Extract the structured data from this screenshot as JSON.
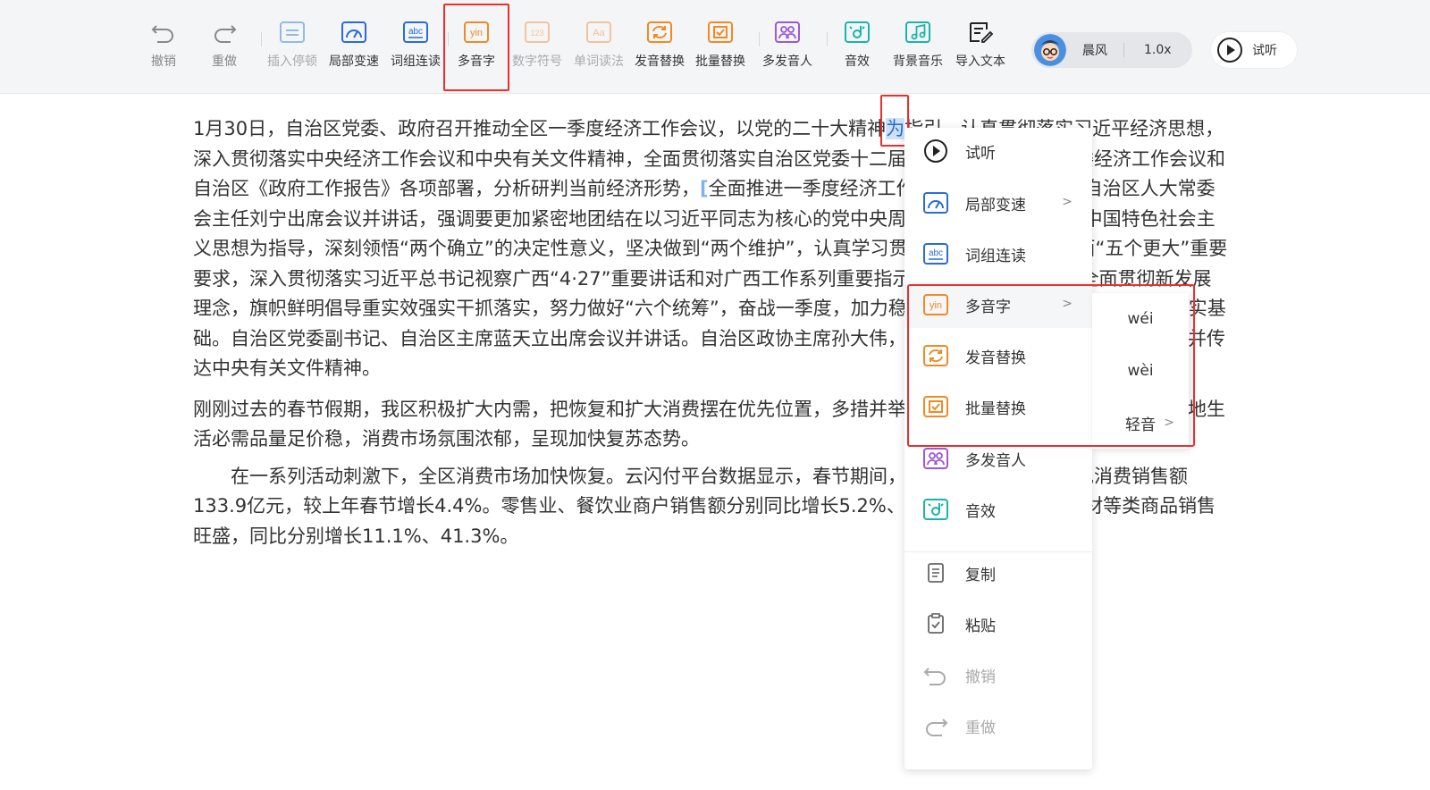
{
  "toolbar": {
    "undo": "撤销",
    "redo": "重做",
    "insert_pause": "插入停顿",
    "local_speed": "局部变速",
    "word_link": "词组连读",
    "polyphone": "多音字",
    "number_symbol": "数字符号",
    "word_reading": "单词读法",
    "pronounce_replace": "发音替换",
    "batch_replace": "批量替换",
    "multi_speaker": "多发音人",
    "sound_effect": "音效",
    "bg_music": "背景音乐",
    "import_text": "导入文本",
    "icon_text_abc": "abc",
    "icon_text_yin": "yin",
    "icon_text_123": "123",
    "icon_text_aa": "Aa"
  },
  "voice": {
    "name": "晨风",
    "speed": "1.0x"
  },
  "listen": {
    "label": "试听"
  },
  "document": {
    "p1_before": "1月30日，自治区党委、政府召开推动全区一季度经济工作会议，以党的二十大精神",
    "p1_sel": "为",
    "p1_after": "指引，认真贯彻落实习近平经济思想，深入贯彻落实中央经济工作会议和中央有关文件精神，全面贯彻落实自治区党委十二届五次全会、自治区党委经济工作会议和自治区《政府工作报告》各项部署，分析研判当前经济形势，",
    "p1_bracket_text": "全面推进一季度经济工作。自治区党委书记、自治区人大常委会主任刘宁出席会议并讲话，强调要更加紧密地团结在以习近平同志为核心的党中央周围",
    "p1_rest": "，以习近平新时代中国特色社会主义思想为指导，深刻领悟“两个确立”的决定性意义，坚决做到“两个维护”，认真学习贯彻习近平总书记对广西“五个更大”重要要求，深入贯彻落实习近平总书记视察广西“4·27”重要讲话和对广西工作系列重要指示要求，完整、准确、全面贯彻新发展理念，旗帜鲜明倡导重实效强实干抓落实，努力做好“六个统筹”，奋战一季度，加力稳增长，为实现全年目标任务打下坚实基础。自治区党委副书记、自治区主席蓝天立出席会议并讲话。自治区政协主席孙大伟，自治区党委副书记刘小明主持会议并传达中央有关文件精神。",
    "p2": "刚刚过去的春节假期，我区积极扩大内需，把恢复和扩大消费摆在优先位置，多措并举促消费、稳增长、保民生，全区各地生活必需品量足价稳，消费市场氛围浓郁，呈现加快复苏态势。",
    "p3": "在一系列活动刺激下，全区消费市场加快恢复。云闪付平台数据显示，春节期间，全区重点监测商户实现消费销售额133.9亿元，较上年春节增长4.4%。零售业、餐饮业商户销售额分别同比增长5.2%、3.1%。家电、通讯器材等类商品销售旺盛，同比分别增长11.1%、41.3%。"
  },
  "context_menu": {
    "listen": "试听",
    "local_speed": "局部变速",
    "word_link": "词组连读",
    "polyphone": "多音字",
    "pronounce_replace": "发音替换",
    "batch_replace": "批量替换",
    "multi_speaker": "多发音人",
    "sound_effect": "音效",
    "copy": "复制",
    "paste": "粘贴",
    "undo": "撤销",
    "redo": "重做",
    "icon_text_abc": "abc",
    "icon_text_yin": "yin"
  },
  "submenu": {
    "opt1": "wéi",
    "opt2": "wèi",
    "opt3": "轻音"
  },
  "arrow_glyph": ">",
  "colors": {
    "accent_blue": "#2a6bd8",
    "orange": "#f08a24",
    "purple": "#9b59d6",
    "teal": "#19b5a8",
    "highlight_red": "#e8302f"
  }
}
